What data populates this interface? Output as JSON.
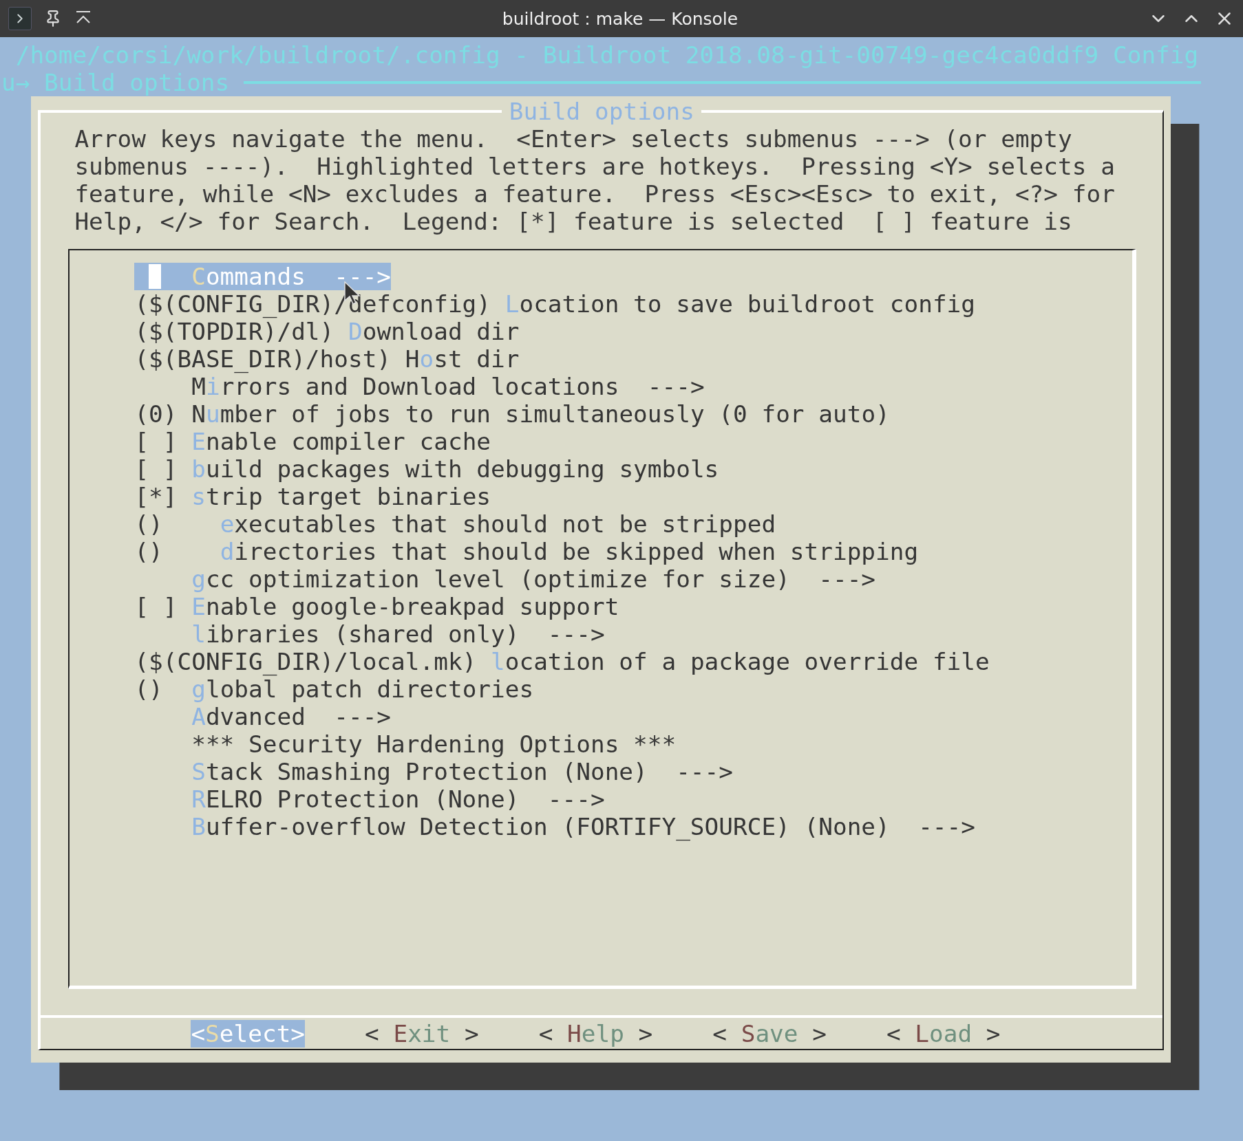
{
  "window": {
    "title": "buildroot : make — Konsole"
  },
  "terminal": {
    "path_line": "/home/corsi/work/buildroot/.config - Buildroot 2018.08-git-00749-gec4ca0ddf9 Config",
    "breadcrumb": "u→ Build options"
  },
  "dialog": {
    "title": "Build options",
    "help_lines": [
      "Arrow keys navigate the menu.  <Enter> selects submenus ---> (or empty",
      "submenus ----).  Highlighted letters are hotkeys.  Pressing <Y> selects a",
      "feature, while <N> excludes a feature.  Press <Esc><Esc> to exit, <?> for",
      "Help, </> for Search.  Legend: [*] feature is selected  [ ] feature is"
    ],
    "items": [
      {
        "hotkey": "C",
        "text": "ommands  --->",
        "selected": true
      },
      {
        "prefix": "($(CONFIG_DIR)/defconfig) ",
        "hotkey": "L",
        "text": "ocation to save buildroot config",
        "selected": false
      },
      {
        "prefix": "($(TOPDIR)/dl) ",
        "hotkey": "D",
        "text": "ownload dir",
        "selected": false
      },
      {
        "prefix": "($(BASE_DIR)/host) ",
        "lead": "H",
        "hotkey": "o",
        "text": "st dir",
        "selected": false
      },
      {
        "lead": "M",
        "hotkey": "i",
        "text": "rrors and Download locations  --->",
        "selected": false
      },
      {
        "prefix": "(0) ",
        "lead": "N",
        "hotkey": "u",
        "text": "mber of jobs to run simultaneously (0 for auto)",
        "selected": false
      },
      {
        "prefix": "[ ] ",
        "hotkey": "E",
        "text": "nable compiler cache",
        "selected": false
      },
      {
        "prefix": "[ ] ",
        "hotkey": "b",
        "text": "uild packages with debugging symbols",
        "selected": false
      },
      {
        "prefix": "[*] ",
        "hotkey": "s",
        "text": "trip target binaries",
        "selected": false
      },
      {
        "prefix": "()    ",
        "hotkey": "e",
        "text": "xecutables that should not be stripped",
        "selected": false
      },
      {
        "prefix": "()    ",
        "hotkey": "d",
        "text": "irectories that should be skipped when stripping",
        "selected": false
      },
      {
        "hotkey": "g",
        "text": "cc optimization level (optimize for size)  --->",
        "selected": false
      },
      {
        "prefix": "[ ] ",
        "hotkey": "E",
        "text": "nable google-breakpad support",
        "selected": false
      },
      {
        "hotkey": "l",
        "text": "ibraries (shared only)  --->",
        "selected": false
      },
      {
        "prefix": "($(CONFIG_DIR)/local.mk) ",
        "hotkey": "l",
        "text": "ocation of a package override file",
        "selected": false
      },
      {
        "prefix": "()  ",
        "hotkey": "g",
        "text": "lobal patch directories",
        "selected": false
      },
      {
        "hotkey": "A",
        "text": "dvanced  --->",
        "selected": false
      },
      {
        "text": "*** Security Hardening Options ***",
        "selected": false
      },
      {
        "hotkey": "S",
        "text": "tack Smashing Protection (None)  --->",
        "selected": false
      },
      {
        "hotkey": "R",
        "text": "ELRO Protection (None)  --->",
        "selected": false
      },
      {
        "hotkey": "B",
        "text": "uffer-overflow Detection (FORTIFY_SOURCE) (None)  --->",
        "selected": false
      }
    ],
    "buttons": [
      {
        "left": "<",
        "hotkey": "S",
        "text": "elect",
        "right": ">",
        "selected": true
      },
      {
        "left": "< ",
        "hotkey": "E",
        "text": "xit",
        "right": " >",
        "selected": false
      },
      {
        "left": "< ",
        "hotkey": "H",
        "text": "elp",
        "right": " >",
        "selected": false
      },
      {
        "left": "< ",
        "hotkey": "S",
        "text": "ave",
        "right": " >",
        "selected": false
      },
      {
        "left": "< ",
        "hotkey": "L",
        "text": "oad",
        "right": " >",
        "selected": false
      }
    ]
  }
}
